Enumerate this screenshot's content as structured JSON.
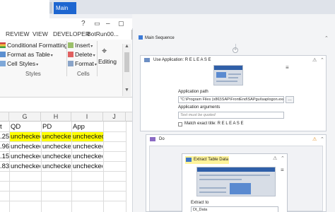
{
  "designer": {
    "tab_label": "Main",
    "sequence_title": "Main Sequence",
    "use_application": {
      "title": "Use Application: R E L E A S E",
      "app_path_label": "Application path",
      "app_path_value": "\"C:\\Program Files (x86)\\SAP\\FrontEnd\\SAPgui\\saplogon.exe\"",
      "app_args_label": "Application arguments",
      "app_args_placeholder": "Text must be quoted",
      "match_title_label": "Match exact title: R E L E A S E"
    },
    "do_block": {
      "title": "Do",
      "extract_title": "Extract Table Data",
      "extract_to_label": "Extract to",
      "extract_to_value": "Dt_Data"
    }
  },
  "excel": {
    "title_controls": [
      "?",
      "▭",
      "–",
      "▢"
    ],
    "ribbon_tabs": [
      "REVIEW",
      "VIEW",
      "DEVELOPER",
      "BotRun00..."
    ],
    "ribbon": {
      "conditional_formatting": "Conditional Formatting",
      "format_as_table": "Format as Table",
      "cell_styles": "Cell Styles",
      "insert": "Insert",
      "delete": "Delete",
      "format": "Format",
      "editing": "Editing",
      "styles_group": "Styles",
      "cells_group": "Cells"
    },
    "column_headers": [
      "G",
      "H",
      "I",
      "J"
    ],
    "header_row": [
      "t",
      "QD",
      "PD",
      "App"
    ],
    "rows": [
      [
        ".25",
        "unchecked",
        "unchecked",
        "unchecked"
      ],
      [
        ".96",
        "unchecked",
        "unchecked",
        "unchecked"
      ],
      [
        ".15",
        "unchecked",
        "unchecked",
        "unchecked"
      ],
      [
        ".83",
        "unchecked",
        "unchecked",
        "unchecked"
      ]
    ],
    "highlight_color": "#ffff00"
  },
  "colors": {
    "tab_blue": "#1e66d0",
    "selection_yellow": "#fff39a"
  }
}
